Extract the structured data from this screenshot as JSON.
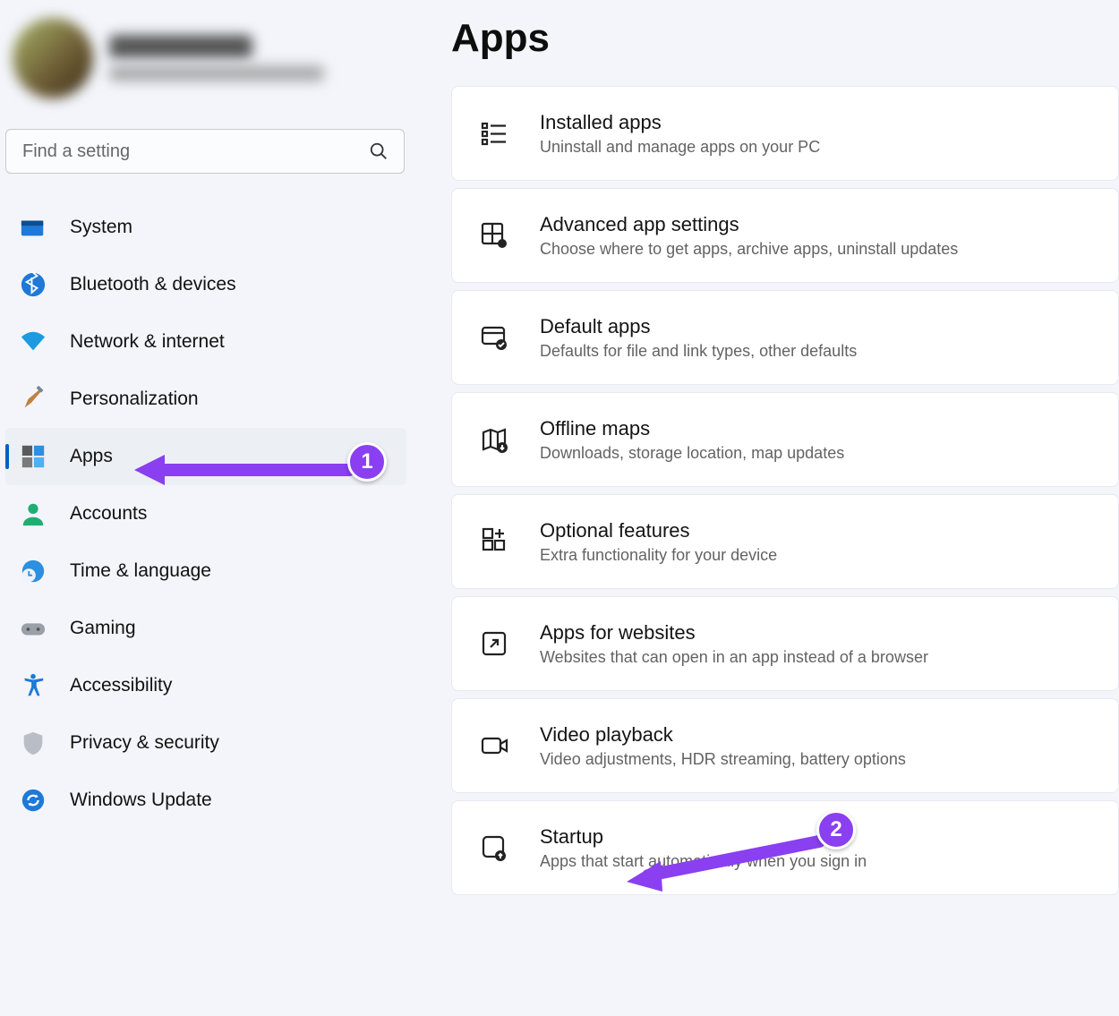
{
  "page_title": "Apps",
  "search": {
    "placeholder": "Find a setting"
  },
  "nav": {
    "items": [
      {
        "label": "System"
      },
      {
        "label": "Bluetooth & devices"
      },
      {
        "label": "Network & internet"
      },
      {
        "label": "Personalization"
      },
      {
        "label": "Apps"
      },
      {
        "label": "Accounts"
      },
      {
        "label": "Time & language"
      },
      {
        "label": "Gaming"
      },
      {
        "label": "Accessibility"
      },
      {
        "label": "Privacy & security"
      },
      {
        "label": "Windows Update"
      }
    ],
    "selected_index": 4
  },
  "cards": [
    {
      "title": "Installed apps",
      "desc": "Uninstall and manage apps on your PC"
    },
    {
      "title": "Advanced app settings",
      "desc": "Choose where to get apps, archive apps, uninstall updates"
    },
    {
      "title": "Default apps",
      "desc": "Defaults for file and link types, other defaults"
    },
    {
      "title": "Offline maps",
      "desc": "Downloads, storage location, map updates"
    },
    {
      "title": "Optional features",
      "desc": "Extra functionality for your device"
    },
    {
      "title": "Apps for websites",
      "desc": "Websites that can open in an app instead of a browser"
    },
    {
      "title": "Video playback",
      "desc": "Video adjustments, HDR streaming, battery options"
    },
    {
      "title": "Startup",
      "desc": "Apps that start automatically when you sign in"
    }
  ],
  "annotations": {
    "badge1": "1",
    "badge2": "2"
  }
}
